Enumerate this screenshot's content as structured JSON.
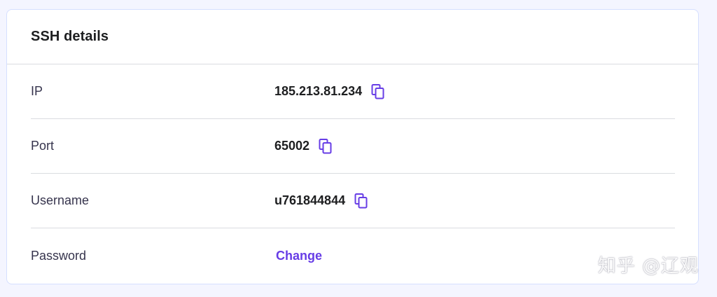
{
  "card": {
    "title": "SSH details"
  },
  "rows": [
    {
      "label": "IP",
      "value": "185.213.81.234",
      "copy_icon": "copy-icon"
    },
    {
      "label": "Port",
      "value": "65002",
      "copy_icon": "copy-icon"
    },
    {
      "label": "Username",
      "value": "u761844844",
      "copy_icon": "copy-icon"
    },
    {
      "label": "Password",
      "action": "Change"
    }
  ],
  "watermark": "知乎 @辽观",
  "colors": {
    "accent": "#673de6",
    "page_bg": "#f4f5ff",
    "text": "#1d1e20",
    "divider": "#dadce0"
  }
}
